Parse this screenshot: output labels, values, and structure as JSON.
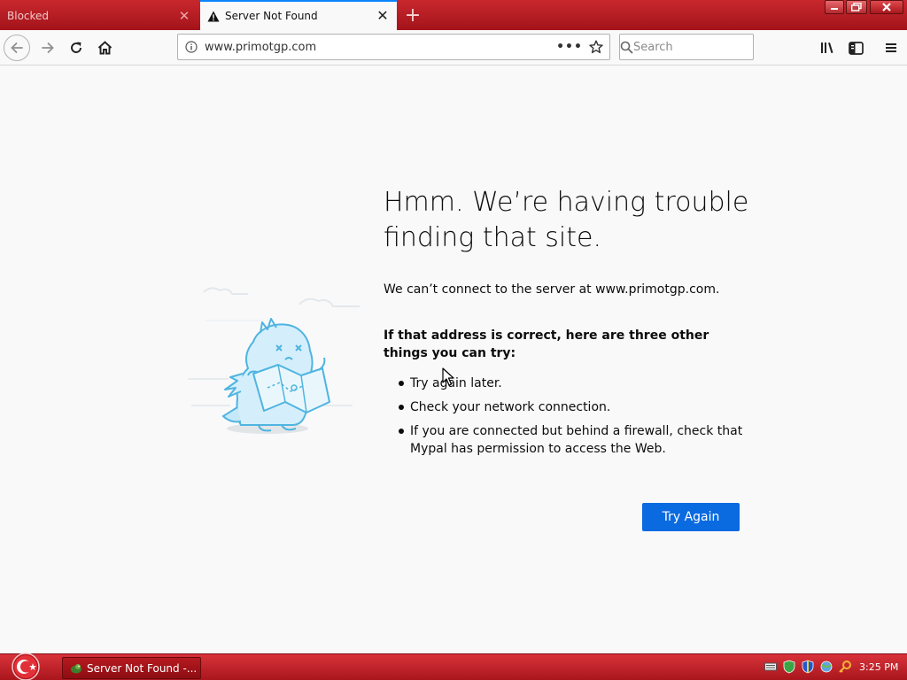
{
  "tabs": [
    {
      "title": "Blocked",
      "active": false
    },
    {
      "title": "Server Not Found",
      "active": true
    }
  ],
  "new_tab_label": "+",
  "nav": {
    "url": "www.primotgp.com",
    "page_actions": "•••",
    "search_placeholder": "Search"
  },
  "error": {
    "title": "Hmm. We’re having trouble finding that site.",
    "description": "We can’t connect to the server at www.primotgp.com.",
    "suggestions_heading": "If that address is correct, here are three other things you can try:",
    "suggestions": [
      "Try again later.",
      "Check your network connection.",
      "If you are connected but behind a firewall, check that Mypal has permission to access the Web."
    ],
    "button_label": "Try Again"
  },
  "taskbar": {
    "window_label": "Server Not Found -...",
    "clock": "3:25 PM"
  },
  "colors": {
    "accent_blue": "#0a6ae0",
    "chrome_red": "#c8282e",
    "taskbar_red": "#d9333a"
  },
  "icons": [
    "warning-icon",
    "back-arrow-icon",
    "forward-arrow-icon",
    "reload-icon",
    "home-icon",
    "info-icon",
    "star-icon",
    "search-icon",
    "library-icon",
    "sidebar-icon",
    "hamburger-menu-icon",
    "dinosaur-illustration",
    "start-orb-icon",
    "mypal-icon",
    "keyboard-icon",
    "shield-icon",
    "network-icon",
    "key-icon"
  ]
}
